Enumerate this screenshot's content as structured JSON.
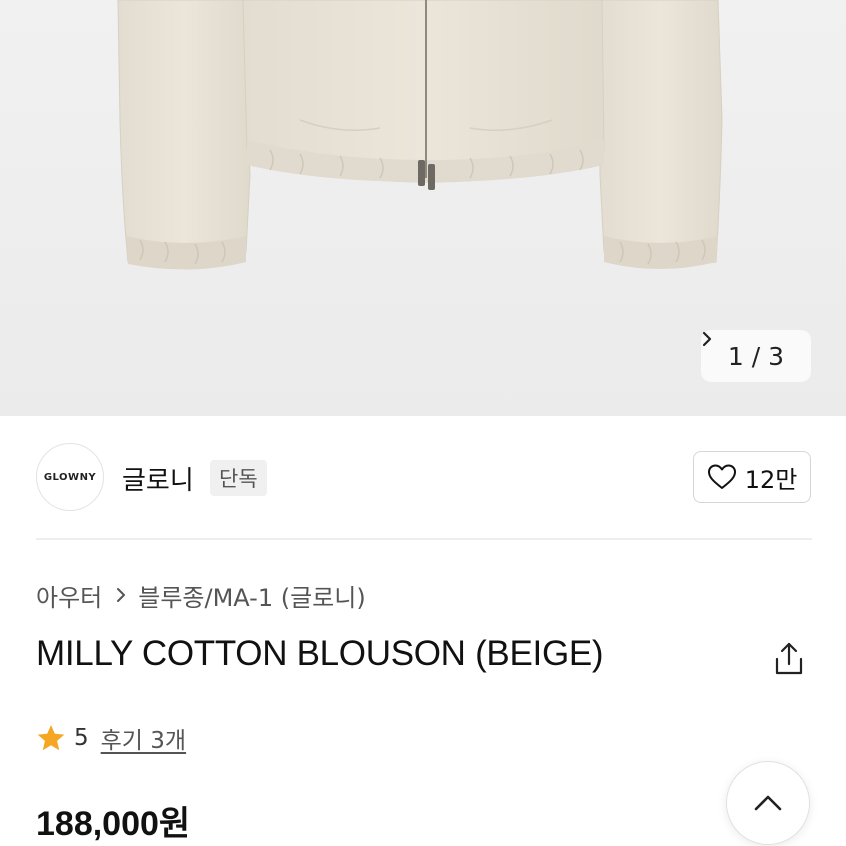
{
  "gallery": {
    "image_alt": "beige cotton blouson jacket",
    "current": "1",
    "separator": "/",
    "total": "3"
  },
  "brand": {
    "logo_text": "GLOWNY",
    "name": "글로니",
    "badge": "단독",
    "likes": "12만"
  },
  "breadcrumb": {
    "items": [
      "아우터",
      "블루종/MA-1 (글로니)"
    ]
  },
  "product": {
    "title": "MILLY COTTON BLOUSON (BEIGE)",
    "rating": "5",
    "reviews": "후기 3개",
    "price": "188,000원"
  },
  "colors": {
    "star": "#F5A623",
    "jacket": "#E7E1D6"
  },
  "icons": {
    "next": "chevron-right-icon",
    "like": "heart-outline-icon",
    "share": "share-icon",
    "star": "star-icon",
    "top": "chevron-up-icon"
  }
}
